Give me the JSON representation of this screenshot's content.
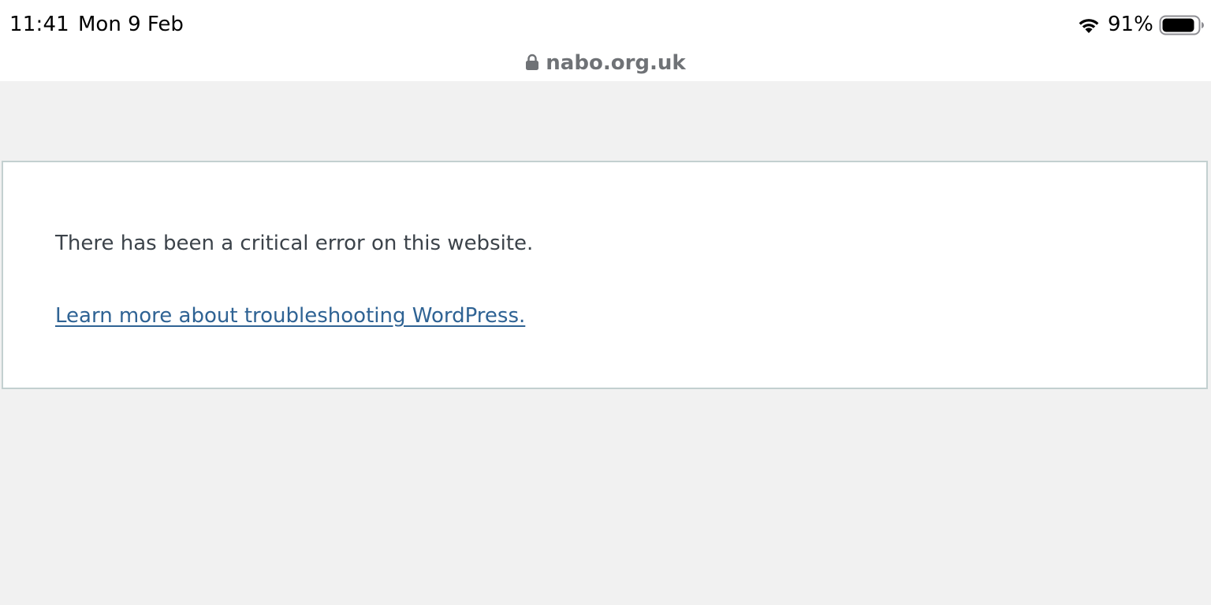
{
  "status_bar": {
    "time": "11:41",
    "date": "Mon 9 Feb",
    "battery_percent": "91%",
    "battery_level": 0.91,
    "wifi_icon": "wifi-icon",
    "battery_icon": "battery-icon"
  },
  "address_bar": {
    "lock_icon": "lock-icon",
    "url": "nabo.org.uk"
  },
  "error_page": {
    "message": "There has been a critical error on this website.",
    "link_text": "Learn more about troubleshooting WordPress."
  },
  "colors": {
    "page_background": "#f1f1f1",
    "box_border": "#c3d0d0",
    "text": "#3c434a",
    "link": "#2f6394",
    "url_text": "#6f7276"
  }
}
